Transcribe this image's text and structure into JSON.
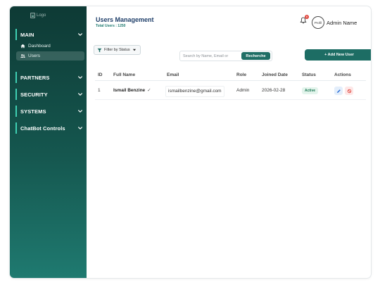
{
  "sidebar": {
    "logo_alt": "Logo",
    "sections": [
      {
        "label": "MAIN"
      },
      {
        "label": "PARTNERS"
      },
      {
        "label": "SECURITY"
      },
      {
        "label": "SYSTEMS"
      },
      {
        "label": "ChatBot Controls"
      }
    ],
    "main_items": [
      {
        "label": "Dashboard",
        "icon": "home-icon"
      },
      {
        "label": "Users",
        "icon": "users-icon",
        "active": true
      }
    ]
  },
  "header": {
    "title": "Users Management",
    "subtitle": "Total Users : 1250",
    "notification_count": "0",
    "avatar_alt": "Profil",
    "admin_name": "Admin Name"
  },
  "toolbar": {
    "filter_label": "Filter by Status",
    "search_placeholder": "Search by Name, Email or",
    "search_value": "",
    "search_button": "Recherche",
    "add_button": "+ Add New User"
  },
  "table": {
    "columns": [
      "ID",
      "Full Name",
      "Email",
      "Role",
      "Joined Date",
      "Status",
      "Actions"
    ],
    "rows": [
      {
        "id": "1",
        "full_name": "Ismail Benzine",
        "verified_mark": "✓",
        "email": "ismailbenzine@gmail.com",
        "role": "Admin",
        "joined_date": "2026-02-28",
        "status": "Active"
      }
    ]
  },
  "colors": {
    "accent": "#1d6d64",
    "sidebar_top": "#0e3a35",
    "sidebar_bottom": "#1f7a70",
    "title": "#1f3f6a",
    "status_active": "#1d7a55",
    "danger": "#e0443b"
  }
}
